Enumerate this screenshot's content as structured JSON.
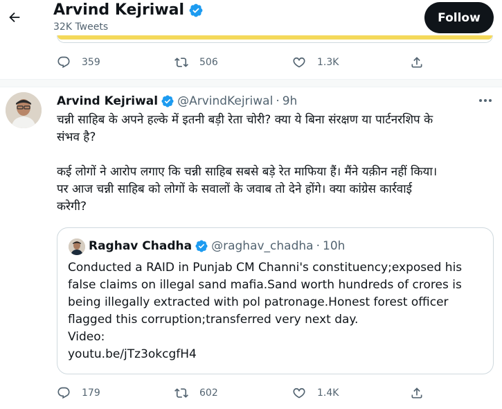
{
  "header": {
    "name": "Arvind Kejriwal",
    "tweet_count": "32K Tweets",
    "follow_label": "Follow"
  },
  "prev_tweet": {
    "replies": "359",
    "retweets": "506",
    "likes": "1.3K"
  },
  "tweet": {
    "name": "Arvind Kejriwal",
    "handle": "@ArvindKejriwal",
    "dot": "·",
    "time": "9h",
    "text_line1": "चन्नी साहिब के अपने हल्के में इतनी बड़ी रेता चोरी? क्या ये बिना संरक्षण या पार्टनरशिप के",
    "text_line2": "संभव है?",
    "text_line3": "कई लोगों ने आरोप लगाए कि चन्नी साहिब सबसे बड़े रेत माफिया हैं। मैंने यक़ीन नहीं किया।",
    "text_line4": "पर आज चन्नी साहिब को लोगों के सवालों के जवाब तो देने होंगे। क्या कांग्रेस कार्रवाई",
    "text_line5": "करेगी?",
    "replies": "179",
    "retweets": "602",
    "likes": "1.4K"
  },
  "quote": {
    "name": "Raghav Chadha",
    "handle": "@raghav_chadha",
    "dot": "·",
    "time": "10h",
    "line1": "Conducted a RAID in Punjab CM Channi's constituency;exposed his",
    "line2": "false claims on illegal sand mafia.Sand worth hundreds of crores is",
    "line3": "being illegally extracted with pol patronage.Honest forest officer",
    "line4": "flagged this corruption;transferred very next day.",
    "line5": "Video:",
    "line6": "youtu.be/jTz3okcgfH4"
  },
  "colors": {
    "verified": "#1d9bf0",
    "muted": "#536471",
    "text": "#0f1419",
    "link": "#536471"
  },
  "icons": [
    "back-arrow-icon",
    "verified-icon",
    "reply-icon",
    "retweet-icon",
    "like-icon",
    "share-icon",
    "more-icon"
  ]
}
